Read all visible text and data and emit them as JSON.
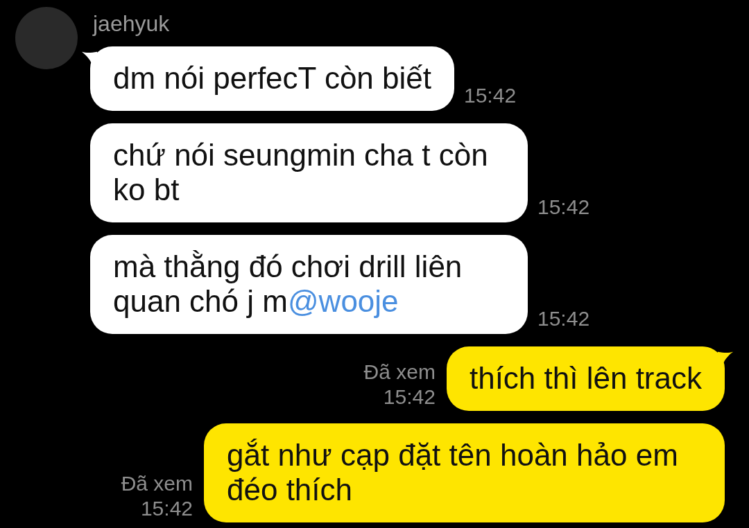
{
  "contact": {
    "name": "jaehyuk"
  },
  "messages": [
    {
      "kind": "incoming",
      "tail": true,
      "text": "dm nói perfecT còn biết",
      "time": "15:42"
    },
    {
      "kind": "incoming",
      "tail": false,
      "text": "chứ nói seungmin cha t còn ko bt",
      "time": "15:42"
    },
    {
      "kind": "incoming",
      "tail": false,
      "text": "mà thằng đó chơi drill liên quan chó j m",
      "mention": "@wooje",
      "time": "15:42"
    },
    {
      "kind": "outgoing",
      "tail": true,
      "text": "thích thì lên track",
      "read_label": "Đã xem",
      "time": "15:42"
    },
    {
      "kind": "outgoing",
      "tail": false,
      "text": "gắt như cạp đặt tên hoàn hảo em đéo thích",
      "read_label": "Đã xem",
      "time": "15:42"
    }
  ]
}
